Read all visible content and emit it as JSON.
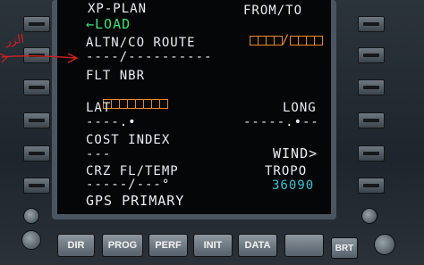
{
  "screen": {
    "title": "XP-PLAN",
    "load": "←LOAD",
    "from_to_label": "FROM/TO",
    "from_to_slash": "/",
    "altn_label": "ALTN/CO ROUTE",
    "altn_value": "----/----------",
    "flt_nbr_label": "FLT NBR",
    "lat_label": "LAT",
    "lat_value": "----.•",
    "long_label": "LONG",
    "long_value": "-----.•--",
    "cost_index_label": "COST INDEX",
    "cost_index_value": "---",
    "wind": "WIND>",
    "crz_label": "CRZ FL/TEMP",
    "crz_value": "-----/---°",
    "tropo_label": "TROPO",
    "tropo_value": "36090",
    "scratchpad": "GPS PRIMARY"
  },
  "keys": {
    "dir": "DIR",
    "prog": "PROG",
    "perf": "PERF",
    "init": "INIT",
    "data": "DATA",
    "brt": "BRT"
  },
  "annotation": {
    "handwriting": "الزر"
  },
  "colors": {
    "screen_bg": "#050607",
    "white_text": "#e9eef1",
    "green_text": "#3fe07a",
    "amber_text": "#e8892b",
    "cyan_text": "#39c3d6",
    "annotation": "#d42020"
  }
}
